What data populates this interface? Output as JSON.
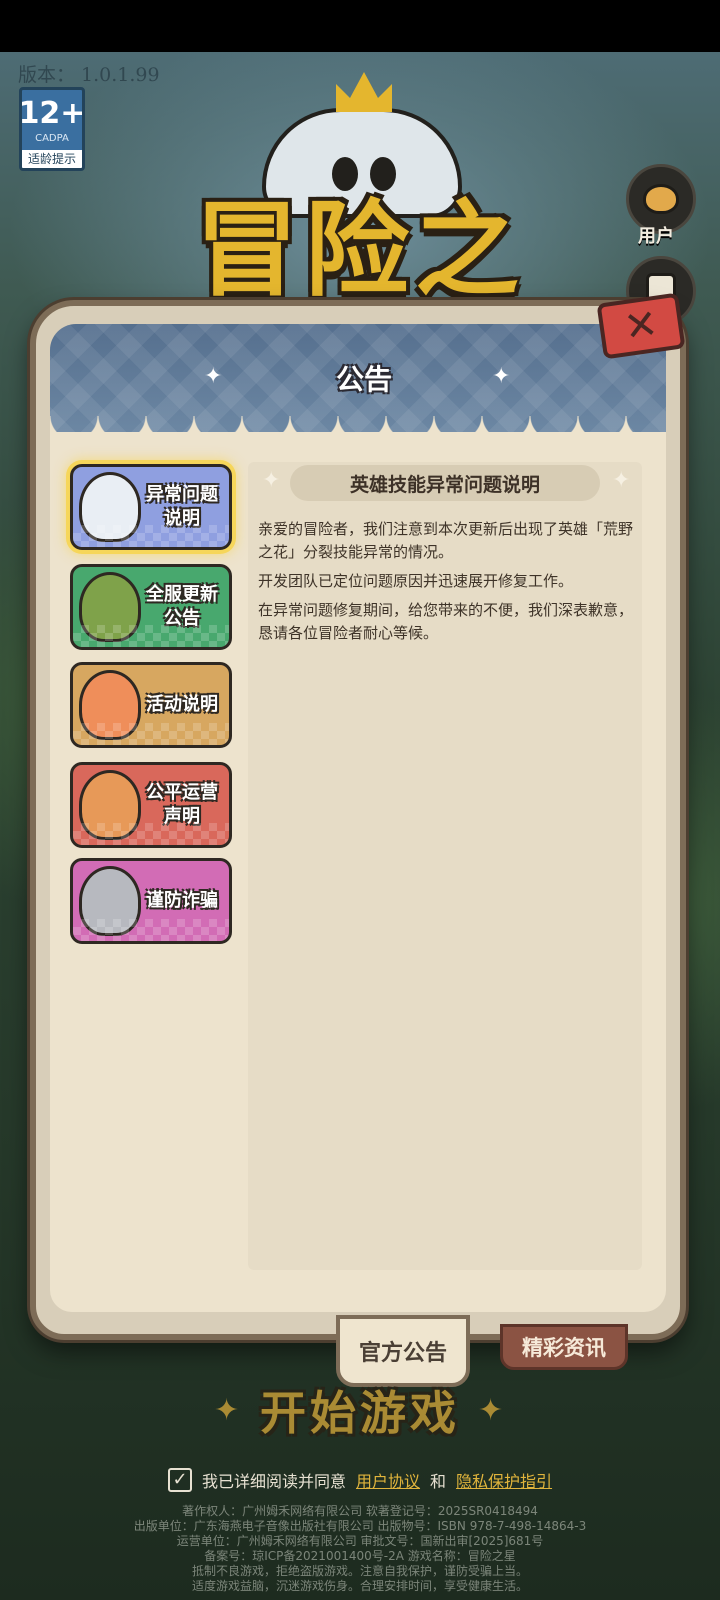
{
  "app": {
    "version": "版本： 1.0.1.99",
    "age_rating": {
      "number": "12+",
      "org": "CADPA",
      "tip": "适龄提示"
    },
    "logo_text": "冒险之星",
    "side_buttons": {
      "user_label": "用户"
    }
  },
  "dialog": {
    "title": "公告",
    "close_icon": "close-icon",
    "categories": [
      {
        "label": "异常问题\n说明",
        "color": "#8f9fe0",
        "art_color": "#e9eef4",
        "active": true
      },
      {
        "label": "全服更新\n公告",
        "color": "#48a86e",
        "art_color": "#7fa24a",
        "active": false
      },
      {
        "label": "活动说明",
        "color": "#d7a760",
        "art_color": "#ef8e5a",
        "active": false
      },
      {
        "label": "公平运营\n声明",
        "color": "#d9685b",
        "art_color": "#e79958",
        "active": false
      },
      {
        "label": "谨防诈骗",
        "color": "#d26cb5",
        "art_color": "#b7b9bf",
        "active": false
      }
    ],
    "content": {
      "title": "英雄技能异常问题说明",
      "paragraphs": [
        "亲爱的冒险者，我们注意到本次更新后出现了英雄「荒野之花」分裂技能异常的情况。",
        "开发团队已定位问题原因并迅速展开修复工作。",
        "在异常问题修复期间，给您带来的不便，我们深表歉意，恳请各位冒险者耐心等候。"
      ]
    },
    "tabs": {
      "official": "官方公告",
      "news": "精彩资讯"
    }
  },
  "footer": {
    "start_button": "开始游戏",
    "agree_text": "我已详细阅读并同意",
    "user_agreement": "用户协议",
    "and": "和",
    "privacy": "隐私保护指引",
    "legal_lines": [
      "著作权人：广州姆禾网络有限公司  软著登记号：2025SR0418494",
      "出版单位：广东海燕电子音像出版社有限公司  出版物号：ISBN 978-7-498-14864-3",
      "运营单位：广州姆禾网络有限公司  审批文号：国新出审[2025]681号",
      "备案号：琼ICP备2021001400号-2A  游戏名称：冒险之星",
      "抵制不良游戏，拒绝盗版游戏。注意自我保护，谨防受骗上当。",
      "适度游戏益脑，沉迷游戏伤身。合理安排时间，享受健康生活。"
    ]
  }
}
